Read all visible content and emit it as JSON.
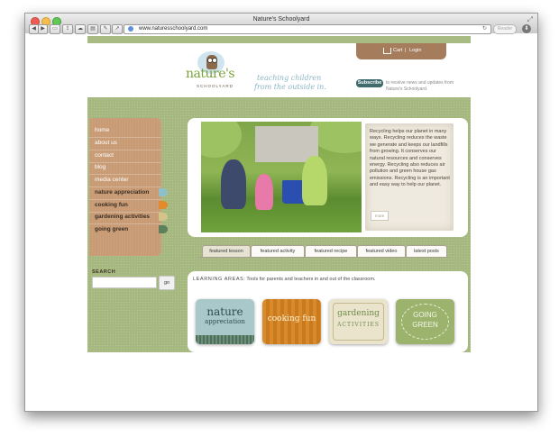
{
  "browser": {
    "title": "Nature's Schoolyard",
    "url": "www.naturesschoolyard.com",
    "reader_label": "Reader",
    "reload_icon": "reload-icon",
    "download_icon": "downloads-icon",
    "toolbar_buttons": [
      "back-icon",
      "forward-icon",
      "bookmarks-icon",
      "share-icon",
      "cloud-icon",
      "history-icon",
      "tools-icon",
      "send-icon"
    ]
  },
  "header": {
    "logo_text": "nature's",
    "logo_subtitle": "SCHOOLYARD",
    "tagline_line1": "teaching children",
    "tagline_line2": "from the outside in.",
    "cart_label": "Cart",
    "separator": "|",
    "login_label": "Login",
    "subscribe_label": "Subscribe",
    "subscribe_text": "to receive news and updates from Nature's Schoolyard."
  },
  "nav": {
    "items": [
      {
        "label": "home"
      },
      {
        "label": "about us"
      },
      {
        "label": "contact"
      },
      {
        "label": "blog"
      },
      {
        "label": "media center"
      },
      {
        "label": "nature appreciation"
      },
      {
        "label": "cooking fun"
      },
      {
        "label": "gardening activities"
      },
      {
        "label": "going green"
      }
    ],
    "category_colors": [
      "#8fc0c7",
      "#e28a2c",
      "#d3c58a",
      "#5d7f5a"
    ]
  },
  "search": {
    "label": "SEARCH",
    "value": "",
    "button_label": "go"
  },
  "feature": {
    "caption": "Recycling helps our planet in many ways. Recycling reduces the waste we generate and keeps our landfills from growing. It conserves our natural resources and conserves energy. Recycling also reduces air pollution and green house gas emissions. Recycling is an important and easy way to help our planet.",
    "more_label": "more"
  },
  "tabs": [
    {
      "label": "featured lesson",
      "active": true
    },
    {
      "label": "featured activity",
      "active": false
    },
    {
      "label": "featured recipe",
      "active": false
    },
    {
      "label": "featured video",
      "active": false
    },
    {
      "label": "latest posts",
      "active": false
    }
  ],
  "learning": {
    "heading": "LEARNING AREAS",
    "separator": ":",
    "description": " Tools for parents and teachers in and out of the classroom.",
    "cards": [
      {
        "line1": "nature",
        "line2": "appreciation"
      },
      {
        "line1": "cooking fun",
        "line2": ""
      },
      {
        "line1": "gardening",
        "line2": "ACTIVITIES"
      },
      {
        "line1": "GOING",
        "line2": "GREEN"
      }
    ]
  }
}
